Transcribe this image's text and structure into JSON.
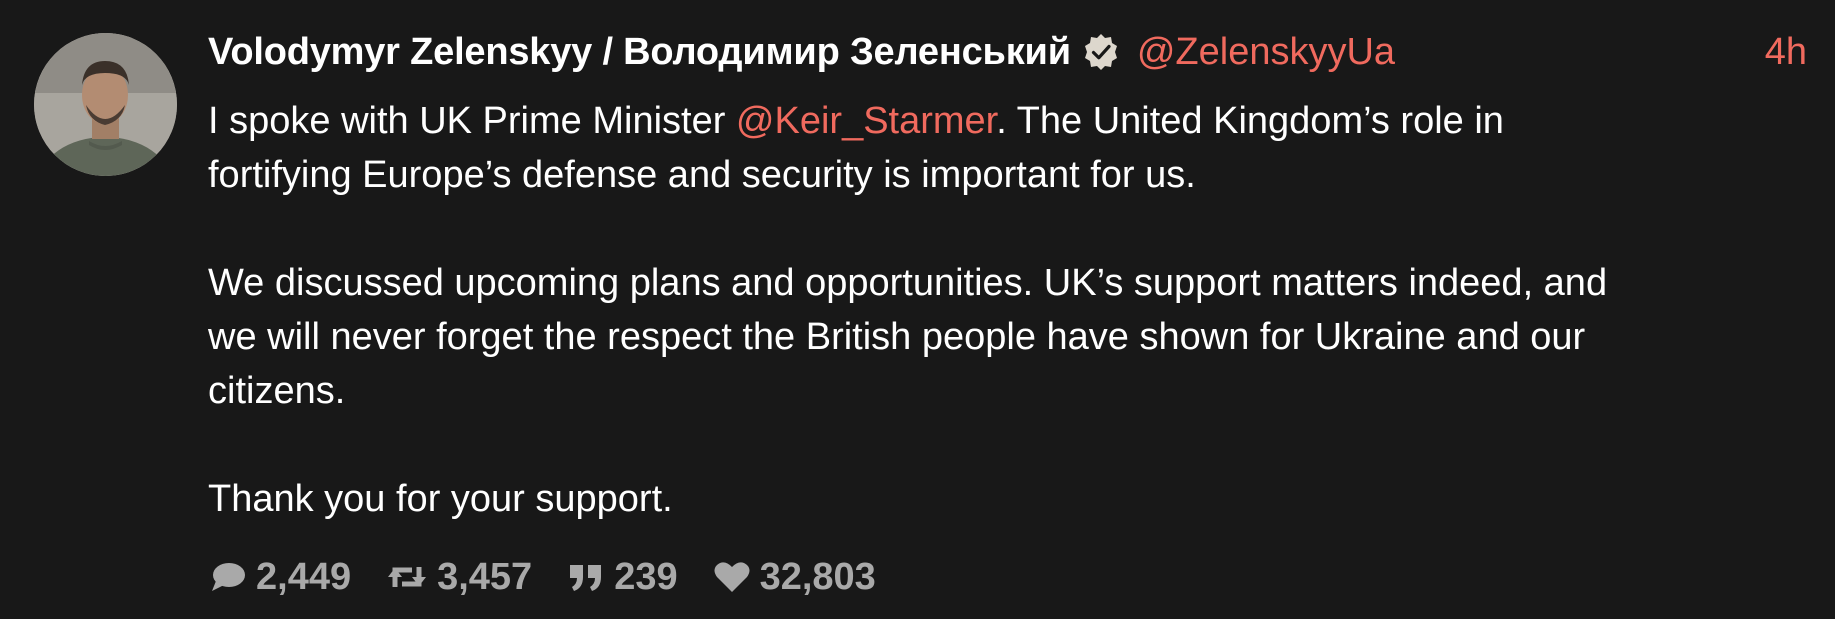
{
  "colors": {
    "background": "#181818",
    "accent": "#f06a5e",
    "text": "#ffffff",
    "muted": "#a9a9a9"
  },
  "author": {
    "display_name": "Volodymyr Zelenskyy / Володимир Зеленський",
    "handle": "@ZelenskyyUa",
    "verified_icon": "verified-badge-icon",
    "avatar_icon": "avatar"
  },
  "timestamp": "4h",
  "body": {
    "p1": {
      "l1_pre": "I spoke with UK Prime Minister ",
      "l1_mention": "@Keir_Starmer",
      "l1_post": ". The United Kingdom’s role in",
      "l2": "fortifying Europe’s defense and security is important for us."
    },
    "p2": {
      "l1": "We discussed upcoming plans and opportunities. UK’s support matters indeed, and",
      "l2": "we will never forget the respect the British people have shown for Ukraine and our",
      "l3": "citizens."
    },
    "p3": {
      "l1": "Thank you for your support."
    }
  },
  "actions": {
    "replies": {
      "icon": "comment-icon",
      "count": "2,449"
    },
    "retweets": {
      "icon": "retweet-icon",
      "count": "3,457"
    },
    "quotes": {
      "icon": "quote-icon",
      "count": "239"
    },
    "likes": {
      "icon": "heart-icon",
      "count": "32,803"
    }
  }
}
